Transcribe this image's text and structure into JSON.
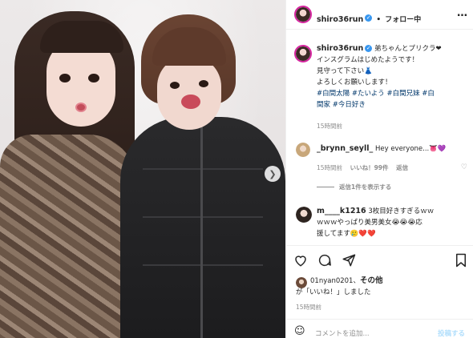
{
  "post": {
    "author": "shiro36run",
    "follow_sep": "•",
    "follow_label": "フォロー中",
    "more": "…",
    "caption_user": "shiro36run",
    "caption_line1": "弟ちゃんとプリクラ❤",
    "caption_line2": "インスグラムはじめたようです！",
    "caption_line3": "見守って下さい👗",
    "caption_line4": "よろしくお願いします！",
    "tags_line1": "#白間太陽 #たいよう #白間兄妹 #白",
    "tags_line2": "間家 #今日好き",
    "caption_time": "15時間前"
  },
  "comments": [
    {
      "user": "_brynn_seyll_",
      "text": "Hey everyone...👅💜",
      "time": "15時間前",
      "likes": "いいね！99件",
      "reply": "返信"
    },
    {
      "view_replies": "返信1件を表示する"
    },
    {
      "user": "m____k1216",
      "text_line1": "3枚目好きすぎるｗｗ",
      "text_line2": "ｗｗｗやっぱり美男美女😭😭😭応",
      "text_line3": "援してます🥲❤️❤️"
    }
  ],
  "likes": {
    "line1_user": "01nyan0201、",
    "line1_rest": "その他",
    "line2": "が「いいね！」しました",
    "time": "15時間前"
  },
  "footer": {
    "placeholder": "コメントを追加...",
    "post_label": "投稿する"
  }
}
